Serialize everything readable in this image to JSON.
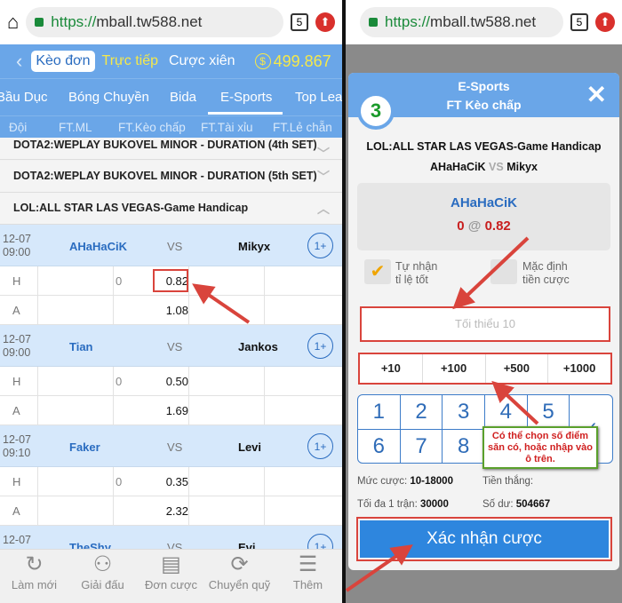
{
  "browser": {
    "url_scheme": "https://",
    "url_host": "mball.tw588.net",
    "tab_count": "5"
  },
  "header": {
    "tabs": [
      "Kèo đơn",
      "Trực tiếp",
      "Cược xiên"
    ],
    "balance": "499.867"
  },
  "sports": [
    "Bầu Dục",
    "Bóng Chuyền",
    "Bida",
    "E-Sports",
    "Top Lea"
  ],
  "columns": [
    "Đội",
    "FT.ML",
    "FT.Kèo chấp",
    "FT.Tài xỉu",
    "FT.Lẻ chẵn"
  ],
  "leagues": [
    "DOTA2:WEPLAY BUKOVEL MINOR - DURATION (4th SET)",
    "DOTA2:WEPLAY BUKOVEL MINOR - DURATION (5th SET)",
    "LOL:ALL STAR LAS VEGAS-Game Handicap"
  ],
  "matches": [
    {
      "date": "12-07",
      "time": "09:00",
      "home": "AHaHaCiK",
      "vs": "VS",
      "away": "Mikyx",
      "more": "1+",
      "h_label": "H",
      "a_label": "A",
      "handicap": "0",
      "h_odd": "0.82",
      "a_odd": "1.08"
    },
    {
      "date": "12-07",
      "time": "09:00",
      "home": "Tian",
      "vs": "VS",
      "away": "Jankos",
      "more": "1+",
      "h_label": "H",
      "a_label": "A",
      "handicap": "0",
      "h_odd": "0.50",
      "a_odd": "1.69"
    },
    {
      "date": "12-07",
      "time": "09:10",
      "home": "Faker",
      "vs": "VS",
      "away": "Levi",
      "more": "1+",
      "h_label": "H",
      "a_label": "A",
      "handicap": "0",
      "h_odd": "0.35",
      "a_odd": "2.32"
    },
    {
      "date": "12-07",
      "home": "TheShy",
      "vs": "VS",
      "away": "Evi",
      "more": "1+"
    }
  ],
  "bottom_nav": [
    {
      "label": "Làm mới",
      "icon": "refresh-icon"
    },
    {
      "label": "Giải đấu",
      "icon": "teams-icon"
    },
    {
      "label": "Đơn cược",
      "icon": "document-icon"
    },
    {
      "label": "Chuyển quỹ",
      "icon": "money-transfer-icon"
    },
    {
      "label": "Thêm",
      "icon": "menu-icon"
    }
  ],
  "betslip": {
    "sport": "E-Sports",
    "market": "FT Kèo chấp",
    "count": "3",
    "league": "LOL:ALL STAR LAS VEGAS-Game Handicap",
    "home": "AHaHaCiK",
    "vs": "VS",
    "away": "Mikyx",
    "selection": "AHaHaCiK",
    "handicap": "0",
    "at": "@",
    "odd": "0.82",
    "opt1": [
      "Tự nhận",
      "tỉ lệ tốt"
    ],
    "opt1_checked": true,
    "opt2": [
      "Mặc định",
      "tiền cược"
    ],
    "opt2_checked": false,
    "amount_placeholder": "Tối thiểu 10",
    "quick": [
      "+10",
      "+100",
      "+500",
      "+1000"
    ],
    "keys": [
      "1",
      "2",
      "3",
      "4",
      "5",
      "6",
      "7",
      "8"
    ],
    "limit_label": "Mức cược:",
    "limit": "10-18000",
    "win_label": "Tiền thắng:",
    "max_label": "Tối đa 1 trận:",
    "max": "30000",
    "balance_label": "Số dư:",
    "balance": "504667",
    "confirm": "Xác nhận cược"
  },
  "annotation": "Có thể chọn số điểm săn có, hoặc nhập vào ô trên.",
  "colors": {
    "primary": "#6aa6e8",
    "accent_red": "#d9443c",
    "balance_yellow": "#f5e84a"
  }
}
